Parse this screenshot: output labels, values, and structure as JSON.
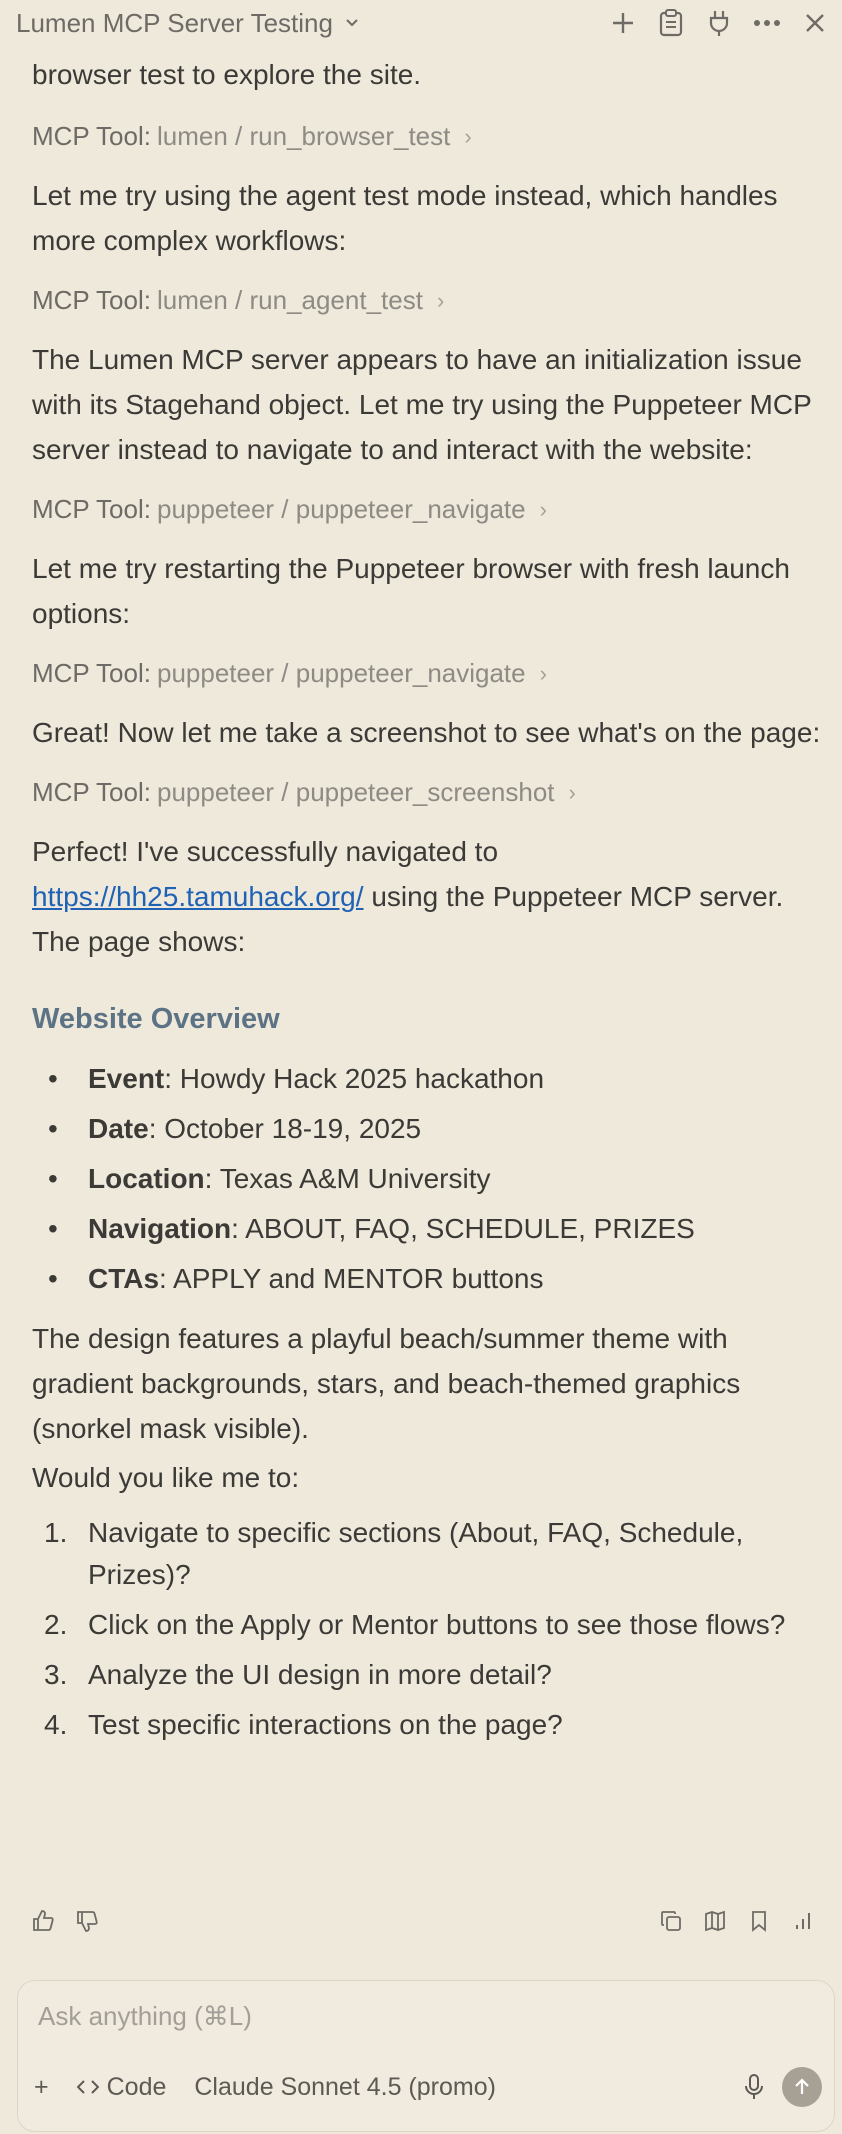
{
  "header": {
    "title": "Lumen MCP Server Testing",
    "icons": [
      "plus-icon",
      "clipboard-icon",
      "plug-icon",
      "more-icon",
      "close-icon"
    ]
  },
  "content": {
    "cutoff_text": "browser test to explore the site.",
    "tool_prefix": "MCP Tool:",
    "tool1": "lumen / run_browser_test",
    "para1": "Let me try using the agent test mode instead, which handles more complex workflows:",
    "tool2": "lumen / run_agent_test",
    "para2": "The Lumen MCP server appears to have an initialization issue with its Stagehand object. Let me try using the Puppeteer MCP server instead to navigate to and interact with the website:",
    "tool3": "puppeteer / puppeteer_navigate",
    "para3": "Let me try restarting the Puppeteer browser with fresh launch options:",
    "tool4": "puppeteer / puppeteer_navigate",
    "para4": "Great! Now let me take a screenshot to see what's on the page:",
    "tool5": "puppeteer / puppeteer_screenshot",
    "para5_pre": "Perfect! I've successfully navigated to",
    "para5_link": "https://hh25.tamuhack.org/",
    "para5_post": "using the Puppeteer MCP server. The page shows:",
    "section_title": "Website Overview",
    "bullets": [
      {
        "label": "Event",
        "text": ": Howdy Hack 2025 hackathon"
      },
      {
        "label": "Date",
        "text": ": October 18-19, 2025"
      },
      {
        "label": "Location",
        "text": ": Texas A&M University"
      },
      {
        "label": "Navigation",
        "text": ": ABOUT, FAQ, SCHEDULE, PRIZES"
      },
      {
        "label": "CTAs",
        "text": ": APPLY and MENTOR buttons"
      }
    ],
    "para6": "The design features a playful beach/summer theme with gradient backgrounds, stars, and beach-themed graphics (snorkel mask visible).",
    "para7": "Would you like me to:",
    "numbered": [
      {
        "n": "1.",
        "text": "Navigate to specific sections (About, FAQ, Schedule, Prizes)?"
      },
      {
        "n": "2.",
        "text": "Click on the Apply or Mentor buttons to see those flows?"
      },
      {
        "n": "3.",
        "text": "Analyze the UI design in more detail?"
      },
      {
        "n": "4.",
        "text": "Test specific interactions on the page?"
      }
    ]
  },
  "composer": {
    "placeholder": "Ask anything (⌘L)",
    "add": "+",
    "code_label": "Code",
    "model_label": "Claude Sonnet 4.5 (promo)"
  },
  "colors": {
    "background": "#efe9dc",
    "link": "#1f62b5",
    "heading": "#5c7285"
  }
}
